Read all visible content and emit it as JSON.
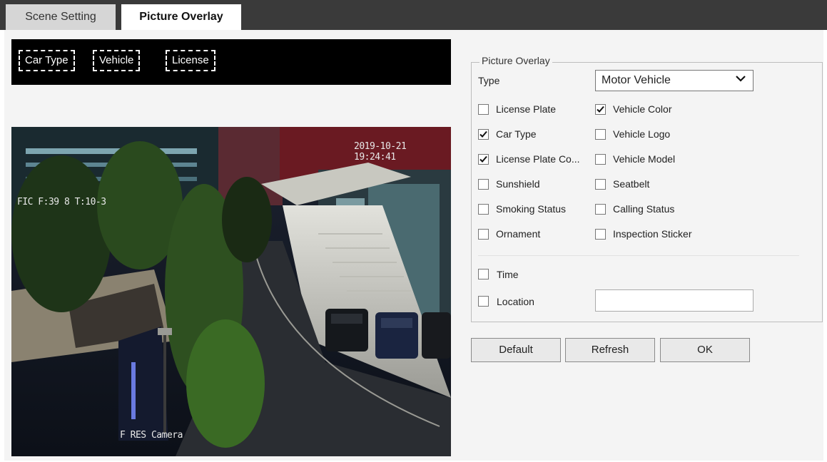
{
  "tabs": [
    {
      "label": "Scene Setting",
      "active": false
    },
    {
      "label": "Picture Overlay",
      "active": true
    }
  ],
  "overlay_preview": {
    "tags": [
      "Car Type",
      "Vehicle",
      "License"
    ]
  },
  "camera": {
    "timestamp": "2019-10-21 19:24:41",
    "location_text": "FIC F:39 8 T:10-3",
    "camera_name": "F RES Camera"
  },
  "settings": {
    "legend": "Picture Overlay",
    "type_label": "Type",
    "type_value": "Motor Vehicle",
    "options": [
      {
        "label": "License Plate",
        "checked": false
      },
      {
        "label": "Vehicle Color",
        "checked": true
      },
      {
        "label": "Car Type",
        "checked": true
      },
      {
        "label": "Vehicle Logo",
        "checked": false
      },
      {
        "label": "License Plate Co...",
        "checked": true
      },
      {
        "label": "Vehicle Model",
        "checked": false
      },
      {
        "label": "Sunshield",
        "checked": false
      },
      {
        "label": "Seatbelt",
        "checked": false
      },
      {
        "label": "Smoking Status",
        "checked": false
      },
      {
        "label": "Calling Status",
        "checked": false
      },
      {
        "label": "Ornament",
        "checked": false
      },
      {
        "label": "Inspection Sticker",
        "checked": false
      }
    ],
    "time_label": "Time",
    "time_checked": false,
    "location_label": "Location",
    "location_checked": false,
    "location_value": ""
  },
  "buttons": {
    "default": "Default",
    "refresh": "Refresh",
    "ok": "OK"
  },
  "colors": {
    "topbar": "#3a3a3a",
    "panel_background": "#f4f4f4",
    "overlay_strip": "#000000"
  }
}
